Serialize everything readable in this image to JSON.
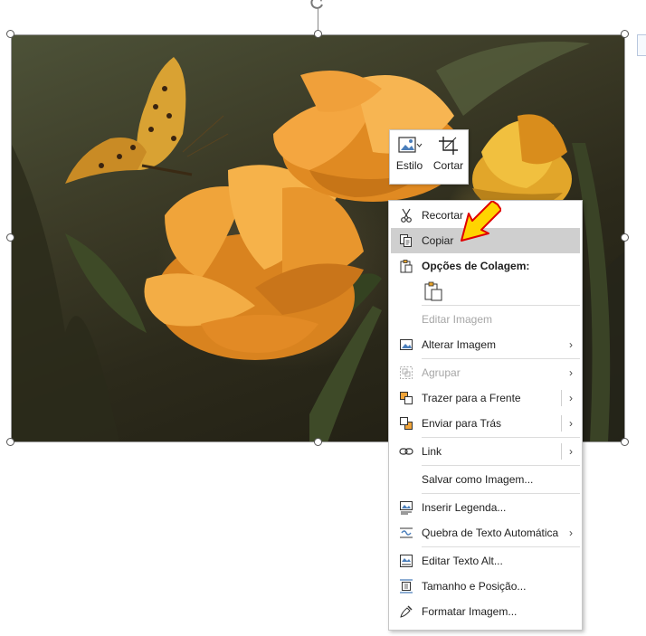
{
  "mini_toolbar": {
    "style_label": "Estilo",
    "crop_label": "Cortar"
  },
  "context_menu": {
    "items": [
      {
        "id": "cut",
        "label": "Recortar",
        "icon": "scissors-icon",
        "disabled": false
      },
      {
        "id": "copy",
        "label": "Copiar",
        "icon": "copy-icon",
        "disabled": false,
        "highlighted": true
      },
      {
        "id": "paste_header",
        "label": "Opções de Colagem:",
        "icon": "clipboard-icon"
      },
      {
        "id": "edit_image",
        "label": "Editar Imagem",
        "disabled": true
      },
      {
        "id": "change_image",
        "label": "Alterar Imagem",
        "icon": "change-picture-icon",
        "submenu": true
      },
      {
        "id": "group",
        "label": "Agrupar",
        "icon": "group-icon",
        "disabled": true,
        "submenu": true
      },
      {
        "id": "bring_front",
        "label": "Trazer para a Frente",
        "icon": "bring-forward-icon",
        "submenu": true
      },
      {
        "id": "send_back",
        "label": "Enviar para Trás",
        "icon": "send-backward-icon",
        "submenu": true
      },
      {
        "id": "link",
        "label": "Link",
        "icon": "link-icon",
        "submenu": true
      },
      {
        "id": "save_image",
        "label": "Salvar como Imagem..."
      },
      {
        "id": "insert_caption",
        "label": "Inserir Legenda...",
        "icon": "caption-icon"
      },
      {
        "id": "wrap_text",
        "label": "Quebra de Texto Automática",
        "icon": "wrap-text-icon",
        "submenu": true
      },
      {
        "id": "edit_alt",
        "label": "Editar Texto Alt...",
        "icon": "alt-text-icon"
      },
      {
        "id": "size_position",
        "label": "Tamanho e Posição...",
        "icon": "size-position-icon"
      },
      {
        "id": "format_image",
        "label": "Formatar Imagem...",
        "icon": "format-picture-icon"
      }
    ]
  },
  "colors": {
    "highlight": "#cfcfcf",
    "disabled_text": "#a6a6a6",
    "arrow_fill": "#ffd400",
    "arrow_stroke": "#e00000"
  }
}
